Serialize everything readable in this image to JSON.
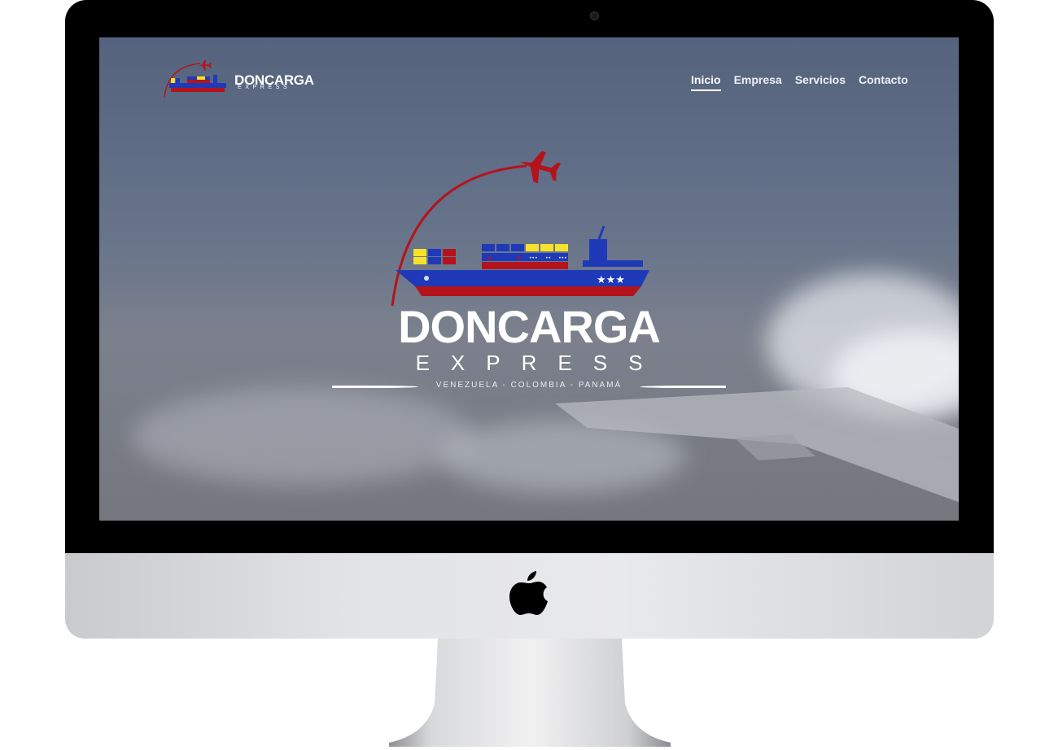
{
  "website": {
    "header_brand": {
      "name": "DONCARGA",
      "sub": "EXPRESS"
    },
    "nav": [
      {
        "label": "Inicio",
        "active": true
      },
      {
        "label": "Empresa",
        "active": false
      },
      {
        "label": "Servicios",
        "active": false
      },
      {
        "label": "Contacto",
        "active": false
      }
    ],
    "hero": {
      "brand": "DONCARGA",
      "sub": "EXPRESS",
      "tagline": "VENEZUELA - COLOMBIA - PANAMÁ"
    }
  },
  "icons": [
    "airplane-icon",
    "cargo-ship-icon",
    "apple-logo-icon",
    "camera-icon"
  ],
  "colors": {
    "brand_red": "#b3141c",
    "brand_blue": "#1f3ab8",
    "brand_yellow": "#f6e12b",
    "text_white": "#ffffff"
  }
}
